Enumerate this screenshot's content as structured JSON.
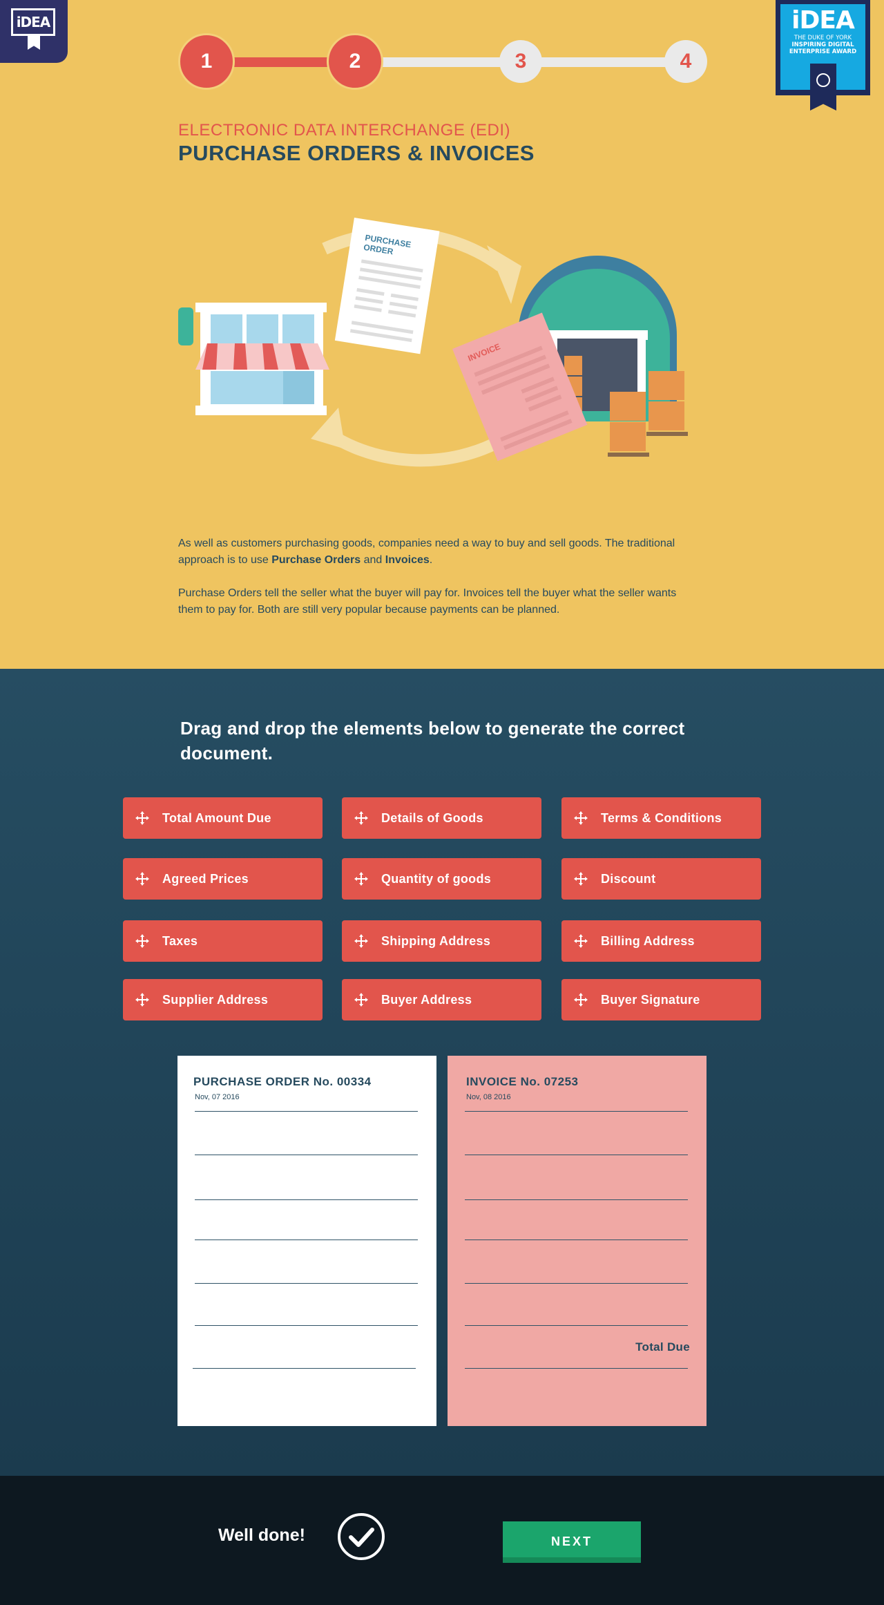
{
  "branding": {
    "logo_text": "iDEA",
    "award_big": "iDEA",
    "award_line1": "THE DUKE OF YORK",
    "award_line2": "INSPIRING DIGITAL",
    "award_line3": "ENTERPRISE AWARD"
  },
  "progress": {
    "current_step": 2,
    "steps": [
      "1",
      "2",
      "3",
      "4"
    ]
  },
  "header": {
    "eyebrow": "ELECTRONIC DATA INTERCHANGE (EDI)",
    "title": "PURCHASE ORDERS & INVOICES"
  },
  "illustration": {
    "po_label_1": "PURCHASE",
    "po_label_2": "ORDER",
    "invoice_label": "INVOICE"
  },
  "intro": {
    "p1_a": "As well as customers purchasing goods, companies need a way to buy and sell goods. The traditional approach is to use ",
    "p1_b": "Purchase Orders",
    "p1_c": " and ",
    "p1_d": "Invoices",
    "p1_e": ".",
    "p2": "Purchase Orders tell the seller what the buyer will pay for. Invoices tell the buyer what the seller wants them to pay for. Both are still very popular because payments can be planned."
  },
  "activity": {
    "prompt": "Drag and drop the elements below to generate the correct document.",
    "chips": [
      "Total Amount Due",
      "Details of Goods",
      "Terms & Conditions",
      "Agreed Prices",
      "Quantity of goods",
      "Discount",
      "Taxes",
      "Shipping Address",
      "Billing Address",
      "Supplier Address",
      "Buyer Address",
      "Buyer Signature"
    ]
  },
  "documents": {
    "po": {
      "title": "PURCHASE ORDER No. 00334",
      "date": "Nov, 07 2016"
    },
    "invoice": {
      "title": "INVOICE  No. 07253",
      "date": "Nov, 08 2016",
      "total_label": "Total Due"
    }
  },
  "footer": {
    "message": "Well done!",
    "next_label": "NEXT"
  },
  "colors": {
    "yellow": "#efc460",
    "red": "#e2554c",
    "navy": "#264a5e",
    "green": "#1ba56c",
    "invoice_pink": "#f0a8a4"
  }
}
